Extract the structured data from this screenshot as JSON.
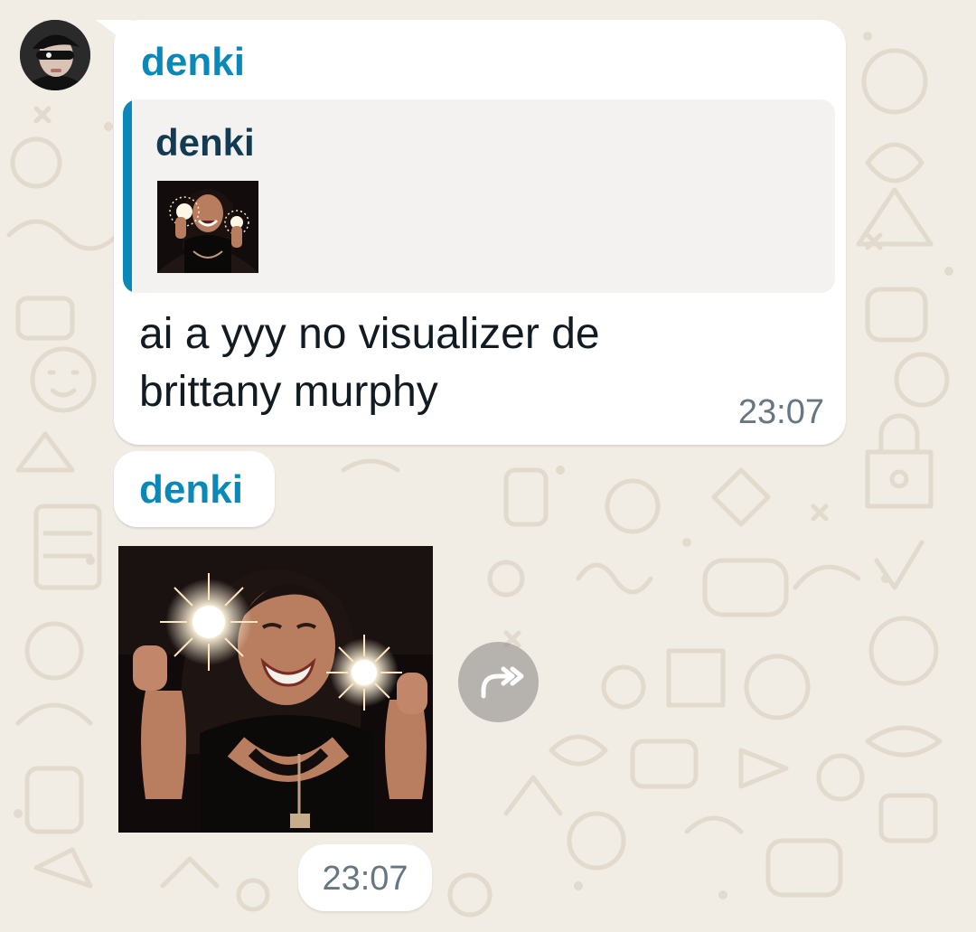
{
  "colors": {
    "background": "#f1ece4",
    "doodle": "#e3dace",
    "bubble": "#ffffff",
    "quote_background": "#f4f2f0",
    "sender_name": "#0a88b8",
    "quote_sender_name": "#123a52",
    "message_text": "#111b21",
    "timestamp": "#667781"
  },
  "chat": {
    "messages": [
      {
        "sender": "denki",
        "avatar_icon": "user-avatar",
        "reply": {
          "sender": "denki",
          "thumbnail": "photo-thumbnail"
        },
        "text": "ai a yyy no visualizer de brittany murphy",
        "time": "23:07"
      },
      {
        "sender": "denki",
        "image": "photo-woman-with-sparklers",
        "forward_icon": "forward-icon",
        "time": "23:07"
      }
    ]
  }
}
